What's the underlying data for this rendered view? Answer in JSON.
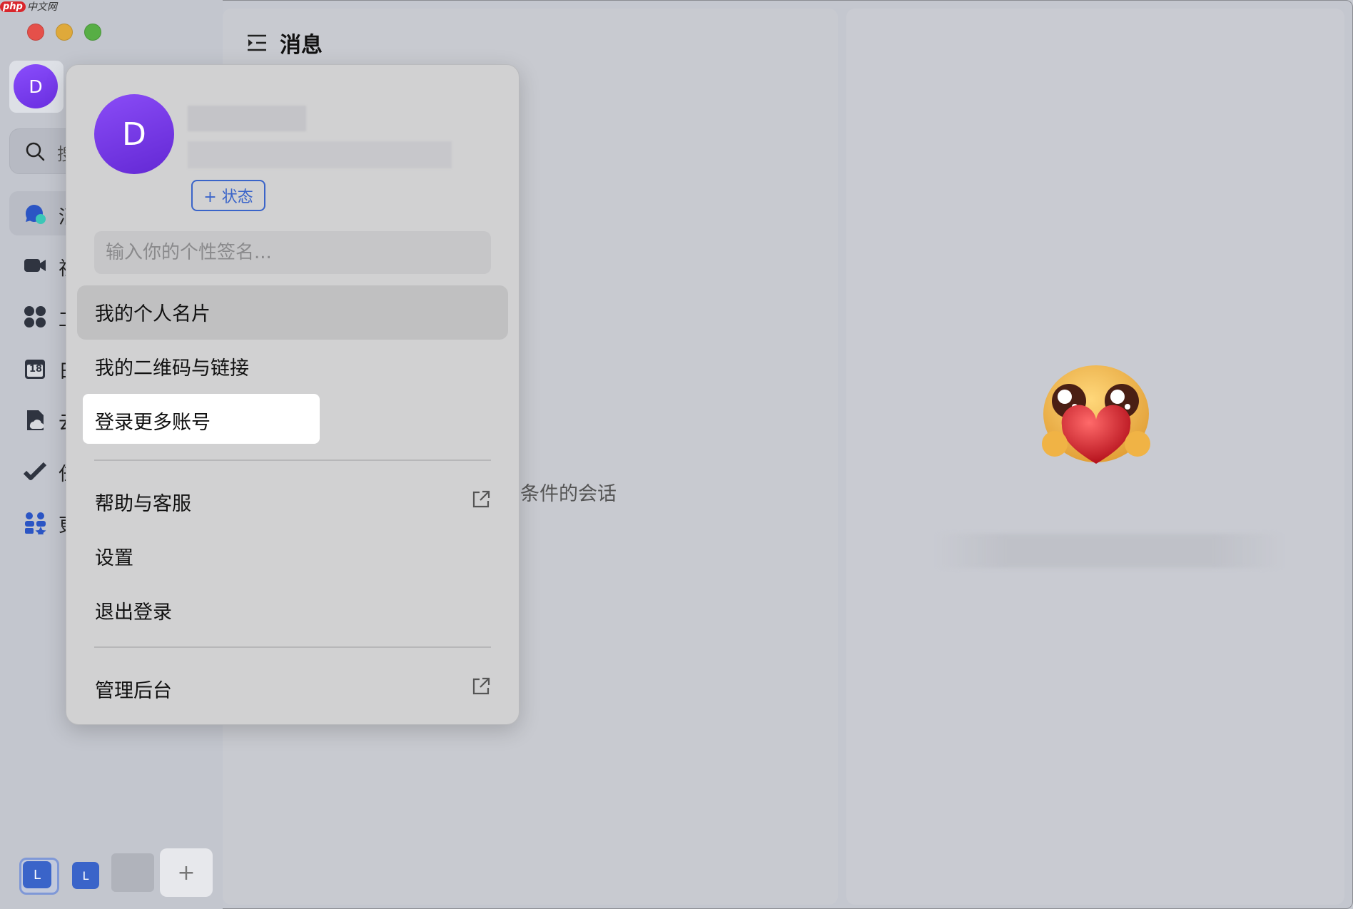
{
  "watermark": {
    "brand": "php",
    "site": "中文网"
  },
  "sidebar": {
    "avatar_initial": "D",
    "search_placeholder": "搜",
    "nav": [
      {
        "id": "messages",
        "label": "消",
        "icon": "chat-bubble-icon"
      },
      {
        "id": "video",
        "label": "视",
        "icon": "video-camera-icon"
      },
      {
        "id": "workbench",
        "label": "工",
        "icon": "apps-grid-icon"
      },
      {
        "id": "calendar",
        "label": "日",
        "icon": "calendar-icon",
        "calendar_day": "18"
      },
      {
        "id": "cloud-docs",
        "label": "云",
        "icon": "cloud-doc-icon"
      },
      {
        "id": "tasks",
        "label": "任",
        "icon": "task-check-icon"
      },
      {
        "id": "more",
        "label": "更",
        "icon": "more-apps-icon"
      }
    ],
    "bottom_accounts": [
      {
        "initial": "L",
        "active": true
      },
      {
        "initial": "L",
        "active": false
      }
    ],
    "add_account_symbol": "+"
  },
  "header": {
    "title": "消息"
  },
  "main": {
    "empty_text": "条件的会话"
  },
  "popover": {
    "avatar_initial": "D",
    "status_button": "+ 状态",
    "signature_placeholder": "输入你的个性签名...",
    "menu": [
      {
        "id": "profile-card",
        "label": "我的个人名片"
      },
      {
        "id": "qr-link",
        "label": "我的二维码与链接"
      },
      {
        "id": "add-account",
        "label": "登录更多账号"
      },
      {
        "id": "help",
        "label": "帮助与客服",
        "external": true
      },
      {
        "id": "settings",
        "label": "设置"
      },
      {
        "id": "logout",
        "label": "退出登录"
      },
      {
        "id": "admin",
        "label": "管理后台",
        "external": true
      }
    ]
  },
  "colors": {
    "accent": "#3a64c9",
    "avatar_purple": "#7a3cf0",
    "popover_bg": "#d1d1d2",
    "highlight": "#ffffff"
  }
}
